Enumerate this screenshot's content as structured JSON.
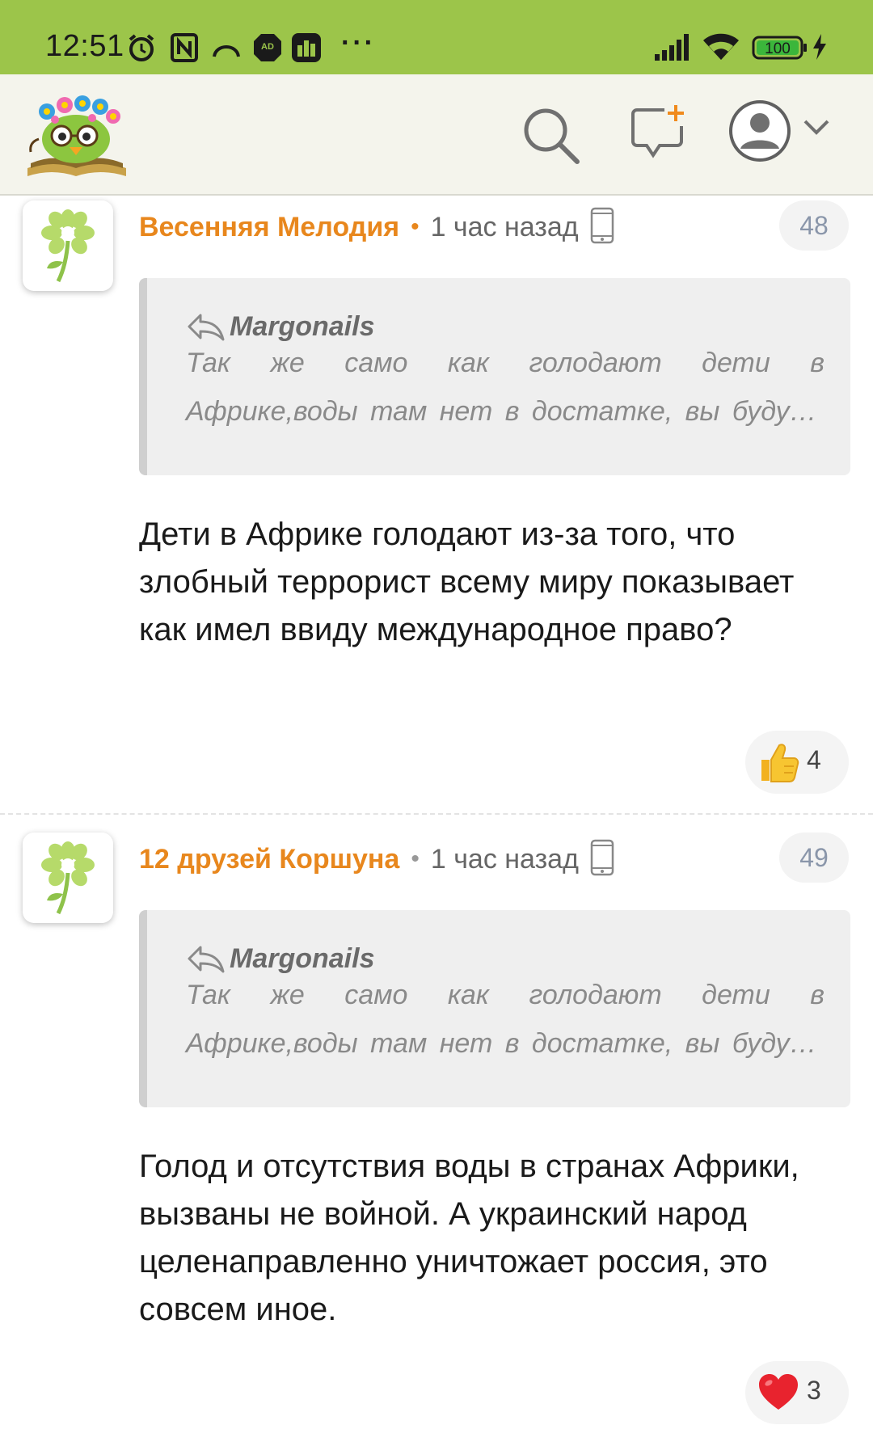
{
  "status_bar": {
    "time": "12:51",
    "battery": "100",
    "icons": [
      "alarm-icon",
      "nfc-icon",
      "cast-icon",
      "adblock-icon",
      "app-icon",
      "more-dots-icon",
      "signal-icon",
      "wifi-icon",
      "battery-icon",
      "charging-icon"
    ],
    "dots": "···"
  },
  "header": {
    "icons": [
      "logo",
      "search-icon",
      "new-message-icon",
      "profile-icon",
      "chevron-down-icon"
    ]
  },
  "comments": [
    {
      "author": "Весенняя Мелодия",
      "separator": "•",
      "time_ago": "1 час назад",
      "number": "48",
      "quote": {
        "author": "Margonails",
        "line1": "Так же само как голодают дети в",
        "line2": "Африке,воды там нет в достатке, вы буду…"
      },
      "text": "Дети в Африке голодают из-за того, что злобный террорист всему миру показывает как имел ввиду международное право?",
      "reaction": {
        "icon": "thumbs-up-icon",
        "count": "4"
      }
    },
    {
      "author": "12 друзей Коршуна",
      "separator": "•",
      "time_ago": "1 час назад",
      "number": "49",
      "quote": {
        "author": "Margonails",
        "line1": "Так же само как голодают дети в",
        "line2": "Африке,воды там нет в достатке, вы буду…"
      },
      "text": "Голод и отсутствия воды в странах Африки, вызваны не войной. А украинский народ целенаправленно уничтожает россия, это совсем иное.",
      "reaction": {
        "icon": "heart-icon",
        "count": "3"
      }
    }
  ],
  "colors": {
    "status_bar": "#9cc54a",
    "header_bg": "#f4f4ec",
    "author": "#e8871d",
    "badge_text": "#8a96aa"
  }
}
